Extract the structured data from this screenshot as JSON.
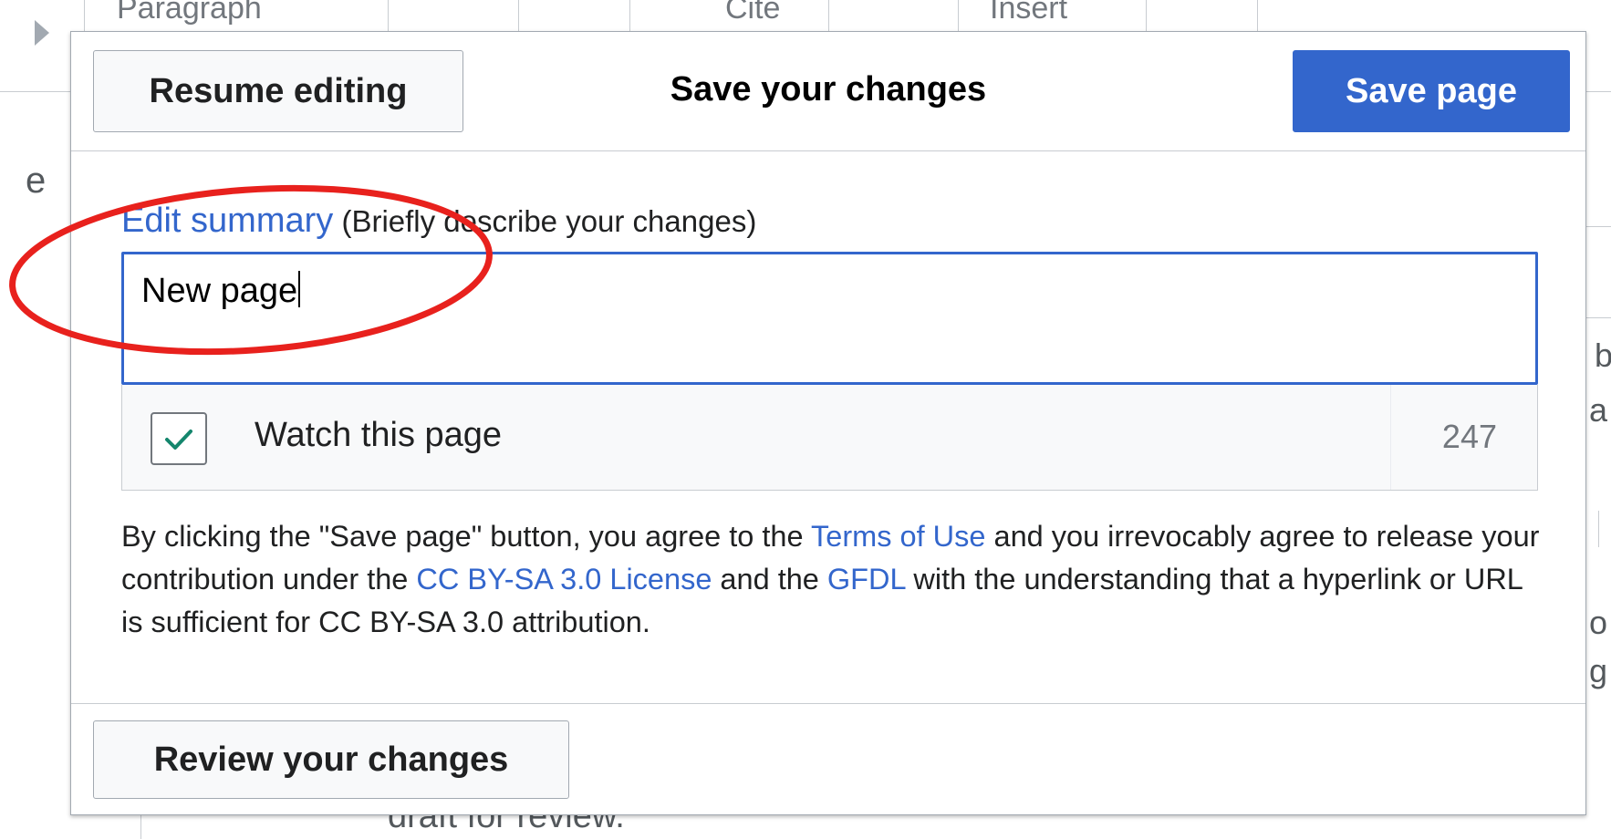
{
  "background": {
    "toolbar": {
      "paragraph_label": "Paragraph",
      "cite_label": "Cite",
      "insert_label": "Insert"
    },
    "bottom_text": "draft for review."
  },
  "dialog": {
    "title": "Save your changes",
    "resume_button": "Resume editing",
    "save_button": "Save page",
    "summary": {
      "label_link": "Edit summary",
      "label_hint": "(Briefly describe your changes)",
      "value": "New page"
    },
    "watch": {
      "label": "Watch this page",
      "checked": true
    },
    "char_counter": "247",
    "license": {
      "t1": "By clicking the \"Save page\" button, you agree to the ",
      "terms_link": "Terms of Use",
      "t2": " and you irrevocably agree to release your contribution under the ",
      "cc_link": "CC BY-SA 3.0 License",
      "t3": " and the ",
      "gfdl_link": "GFDL",
      "t4": " with the understanding that a hyperlink or URL is sufficient for CC BY-SA 3.0 attribution."
    },
    "review_button": "Review your changes"
  },
  "colors": {
    "accent": "#3366cc",
    "annotation": "#e8211d",
    "check": "#14866d"
  },
  "icons": {
    "checkbox": "checkmark-icon",
    "annotation": "red-ellipse-annotation"
  }
}
